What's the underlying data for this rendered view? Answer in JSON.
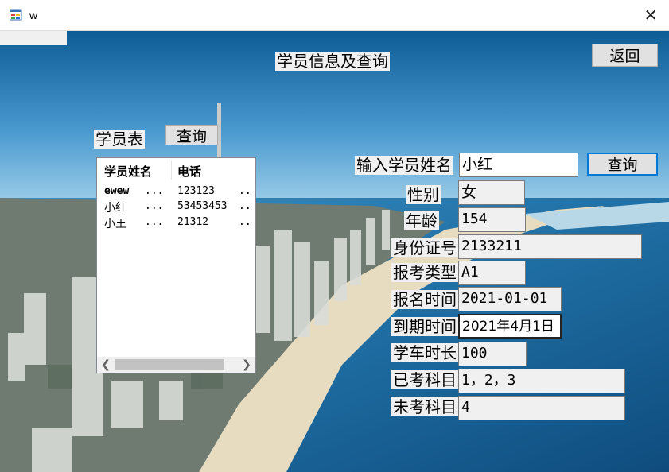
{
  "window": {
    "title": "w",
    "close_glyph": "✕"
  },
  "header": {
    "title": "学员信息及查询"
  },
  "back_button": {
    "label": "返回"
  },
  "student_table": {
    "label": "学员表",
    "query_button": "查询",
    "columns": [
      "学员姓名",
      "电话"
    ],
    "rows": [
      {
        "name": "ewew",
        "phone": "123123"
      },
      {
        "name": "小红",
        "phone": "53453453"
      },
      {
        "name": "小王",
        "phone": "21312"
      }
    ],
    "ellipsis": "...",
    "ellipsis_short": ".."
  },
  "search": {
    "label": "输入学员姓名",
    "value": "小红",
    "button": "查询"
  },
  "details": {
    "gender": {
      "label": "性别",
      "value": "女"
    },
    "age": {
      "label": "年龄",
      "value": "154"
    },
    "id_number": {
      "label": "身份证号",
      "value": "2133211"
    },
    "exam_type": {
      "label": "报考类型",
      "value": "A1"
    },
    "register_time": {
      "label": "报名时间",
      "value": "2021-01-01"
    },
    "expire_time": {
      "label": "到期时间",
      "value": "2021年4月1日"
    },
    "study_hours": {
      "label": "学车时长",
      "value": "100"
    },
    "taken_subjects": {
      "label": "已考科目",
      "value": "1，2，3"
    },
    "pending_subjects": {
      "label": "未考科目",
      "value": "4"
    }
  },
  "colors": {
    "accent": "#0078d7",
    "control_bg": "#f0f0f0",
    "button_bg": "#e1e1e1"
  }
}
